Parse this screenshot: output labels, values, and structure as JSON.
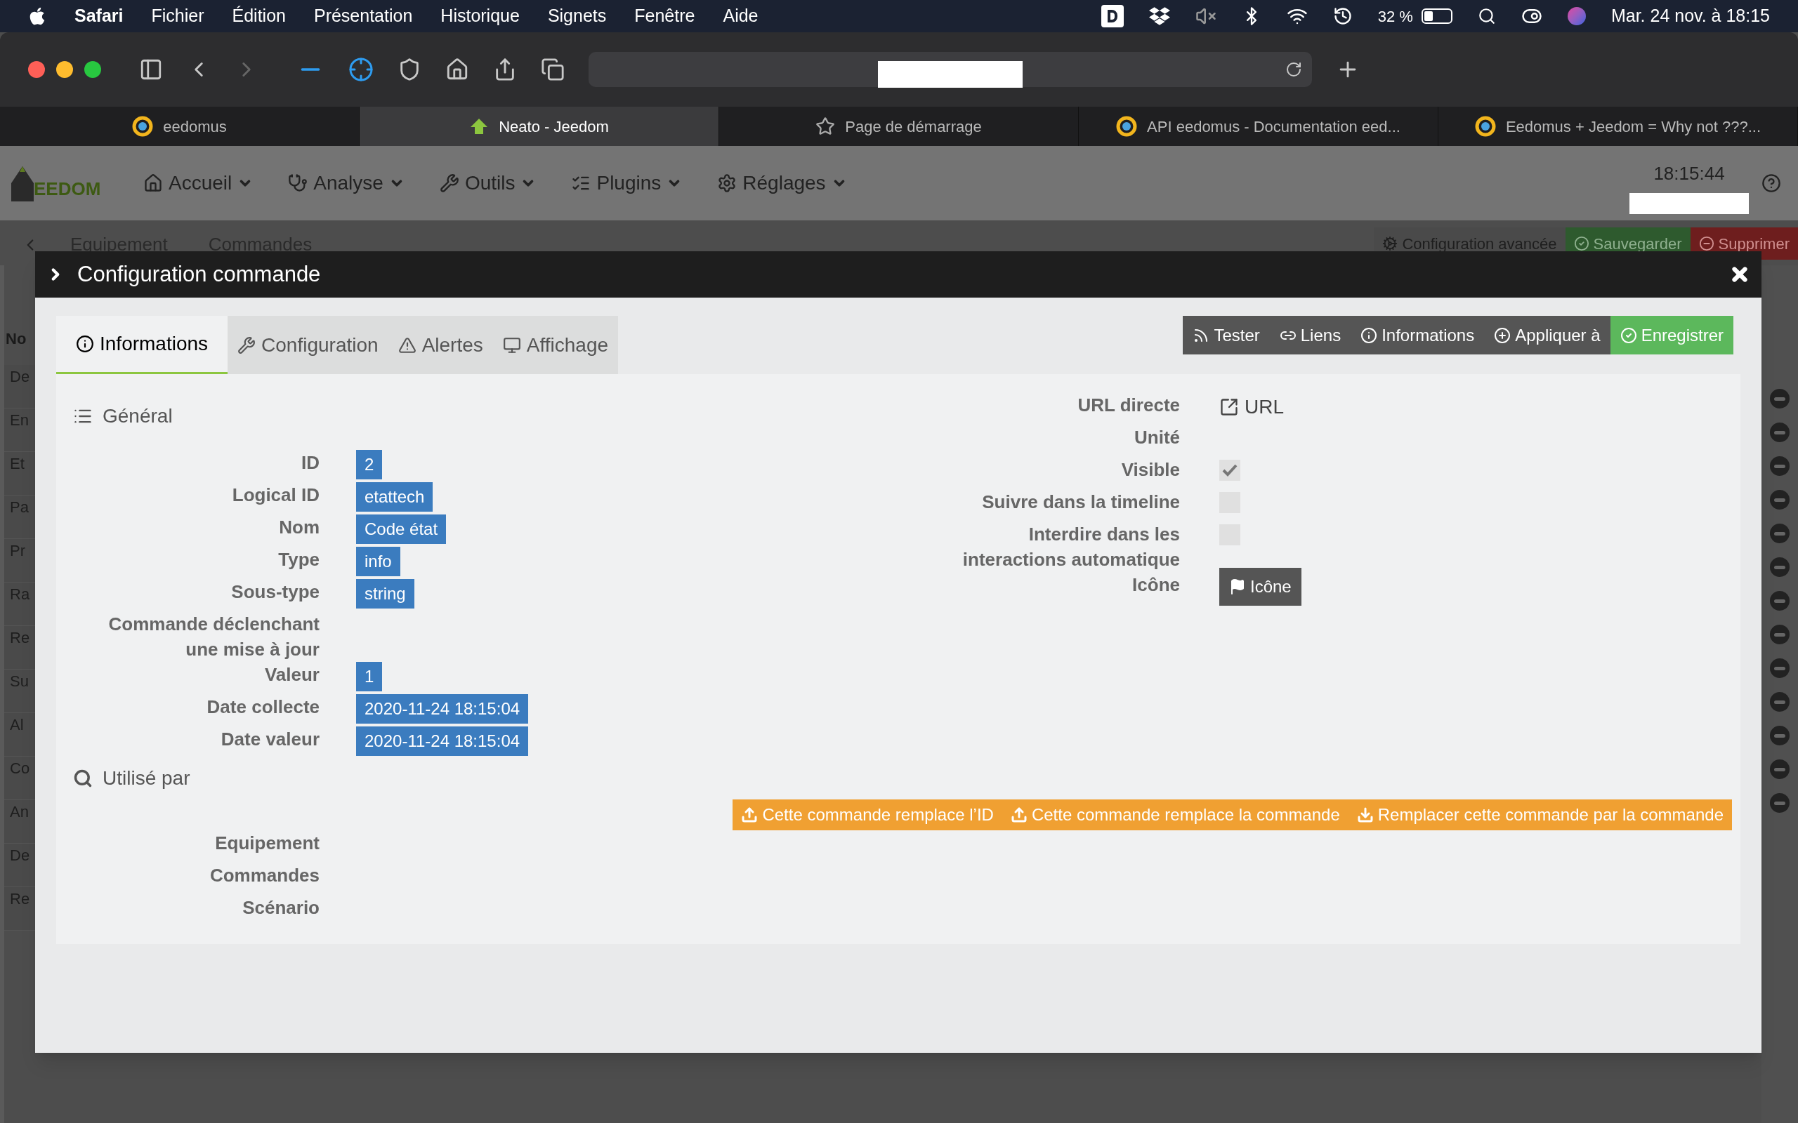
{
  "menu_bar": {
    "app": "Safari",
    "items": [
      "Fichier",
      "Édition",
      "Présentation",
      "Historique",
      "Signets",
      "Fenêtre",
      "Aide"
    ],
    "battery": "32 %",
    "datetime": "Mar. 24 nov. à 18:15"
  },
  "browser_tabs": [
    {
      "title": "eedomus",
      "selected": false
    },
    {
      "title": "Neato - Jeedom",
      "selected": true
    },
    {
      "title": "Page de démarrage",
      "selected": false
    },
    {
      "title": "API eedomus - Documentation eed...",
      "selected": false
    },
    {
      "title": "Eedomus + Jeedom = Why not ???...",
      "selected": false
    }
  ],
  "navbar": {
    "logo": "EEDOM",
    "menus": [
      "Accueil",
      "Analyse",
      "Outils",
      "Plugins",
      "Réglages"
    ],
    "clock": "18:15:44"
  },
  "background_page": {
    "tabs": [
      "Equipement",
      "Commandes"
    ],
    "buttons": [
      {
        "label": "Configuration avancée",
        "kind": "default"
      },
      {
        "label": "Sauvegarder",
        "kind": "success"
      },
      {
        "label": "Supprimer",
        "kind": "danger"
      }
    ],
    "column_header": "No",
    "rows": [
      "De",
      "En",
      "Et",
      "Pa",
      "Pr",
      "Ra",
      "Re",
      "Su",
      "Al",
      "Co",
      "An",
      "De",
      "Re"
    ]
  },
  "modal": {
    "title": "Configuration commande",
    "tabs": [
      {
        "label": "Informations",
        "selected": true
      },
      {
        "label": "Configuration",
        "selected": false
      },
      {
        "label": "Alertes",
        "selected": false
      },
      {
        "label": "Affichage",
        "selected": false
      }
    ],
    "actions": [
      {
        "label": "Tester",
        "kind": "default"
      },
      {
        "label": "Liens",
        "kind": "default"
      },
      {
        "label": "Informations",
        "kind": "default"
      },
      {
        "label": "Appliquer à",
        "kind": "default"
      },
      {
        "label": "Enregistrer",
        "kind": "success"
      }
    ],
    "general_title": "Général",
    "fields": [
      {
        "label": "ID",
        "value": "2"
      },
      {
        "label": "Logical ID",
        "value": "etattech"
      },
      {
        "label": "Nom",
        "value": "Code état"
      },
      {
        "label": "Type",
        "value": "info"
      },
      {
        "label": "Sous-type",
        "value": "string"
      },
      {
        "label": "Commande déclenchant une mise à jour"
      },
      {
        "label": "Valeur",
        "value": "1"
      },
      {
        "label": "Date collecte",
        "value": "2020-11-24 18:15:04"
      },
      {
        "label": "Date valeur",
        "value": "2020-11-24 18:15:04"
      }
    ],
    "options": [
      {
        "label": "URL directe",
        "kind": "link",
        "value": "URL"
      },
      {
        "label": "Unité",
        "kind": "text"
      },
      {
        "label": "Visible",
        "kind": "checkbox",
        "checked": true
      },
      {
        "label": "Suivre dans la timeline",
        "kind": "checkbox",
        "checked": false
      },
      {
        "label": "Interdire dans les interactions automatique",
        "kind": "checkbox",
        "checked": false
      },
      {
        "label": "Icône",
        "kind": "button",
        "value": "Icône"
      }
    ],
    "used_by_title": "Utilisé par",
    "replace_buttons": [
      {
        "label": "Cette commande remplace l’ID",
        "kind": "upload"
      },
      {
        "label": "Cette commande remplace la commande",
        "kind": "upload"
      },
      {
        "label": "Remplacer cette commande par la commande",
        "kind": "download"
      }
    ],
    "used_by": [
      "Equipement",
      "Commandes",
      "Scénario"
    ]
  }
}
